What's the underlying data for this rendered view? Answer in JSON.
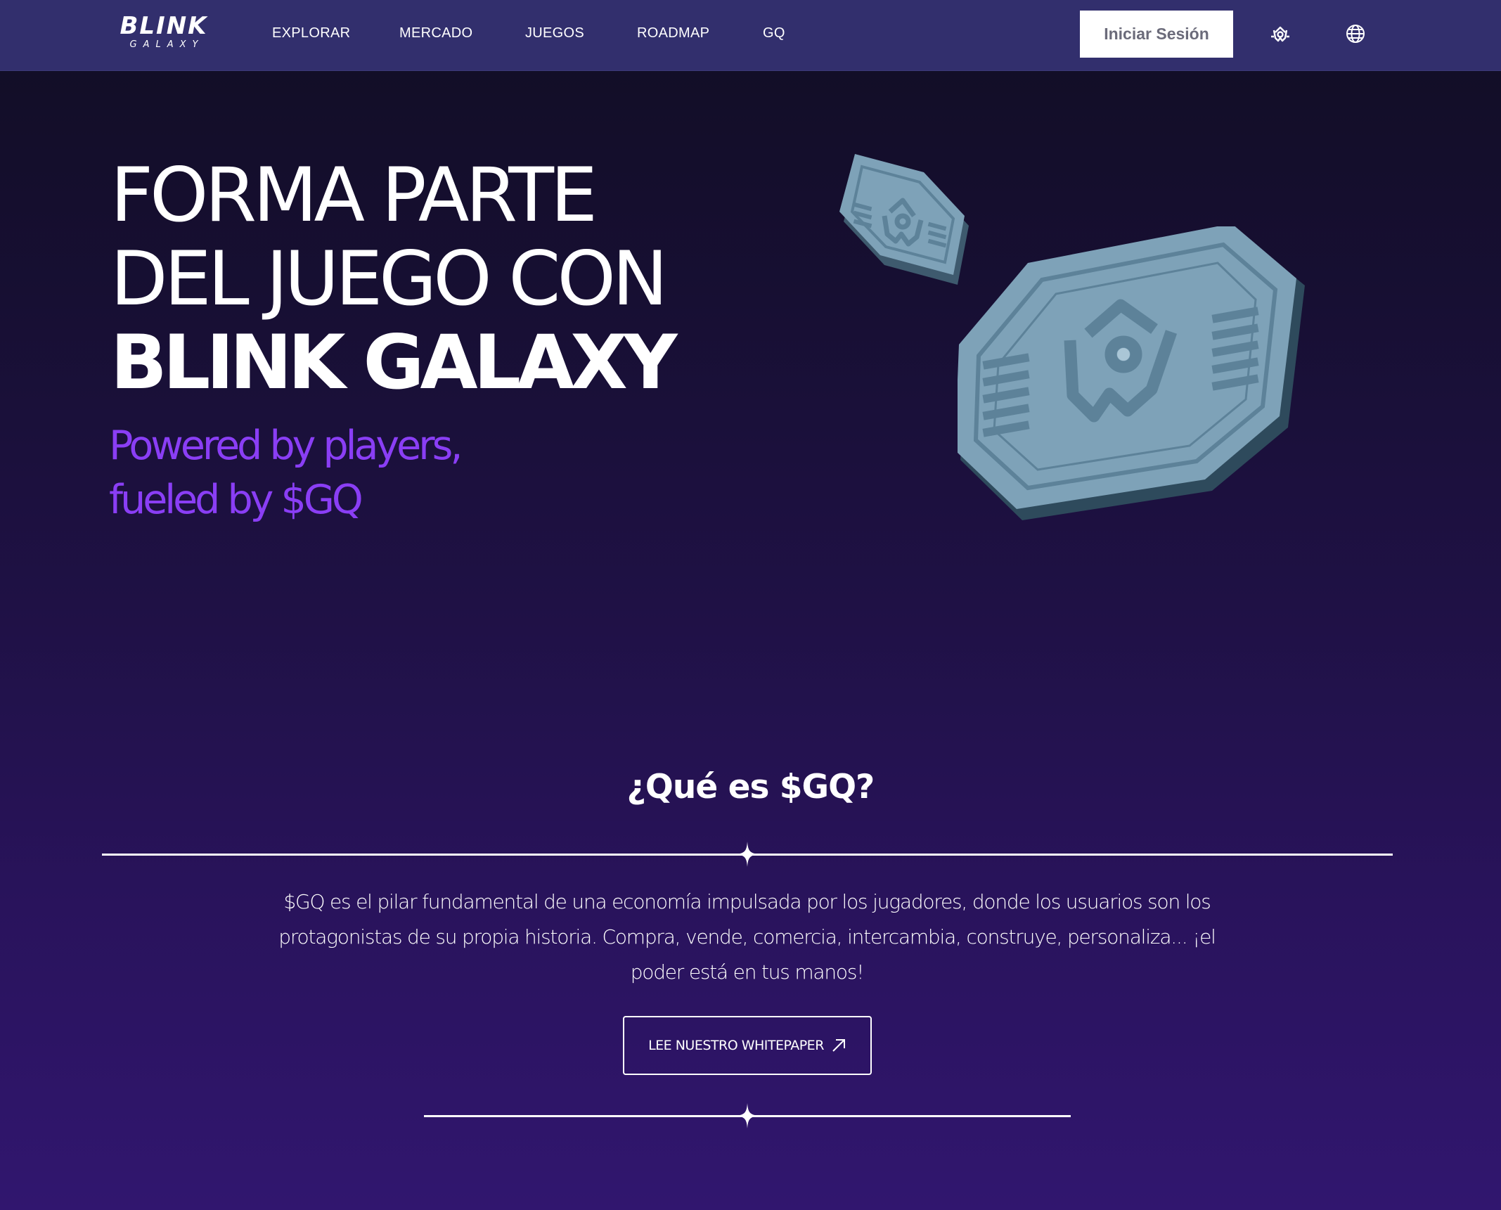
{
  "navbar": {
    "logo_main": "BLINK",
    "logo_sub": "GALAXY",
    "links": [
      "EXPLORAR",
      "MERCADO",
      "JUEGOS",
      "ROADMAP",
      "GQ"
    ],
    "login_label": "Iniciar Sesión",
    "icons": [
      "gq-token-icon",
      "globe-icon"
    ]
  },
  "hero": {
    "title_line1": "FORMA PARTE",
    "title_line2": "DEL JUEGO CON",
    "title_line3": "BLINK GALAXY",
    "subtitle_line1": "Powered by players,",
    "subtitle_line2": "fueled by $GQ"
  },
  "about": {
    "title": "¿Qué es $GQ?",
    "text": "$GQ es el pilar fundamental de una economía impulsada por los jugadores, donde los usuarios son los protagonistas de su propia historia. Compra, vende, comercia, intercambia, construye, personaliza... ¡el poder está en tus manos!",
    "button_label": "LEE NUESTRO WHITEPAPER"
  },
  "colors": {
    "navbar_bg": "#322f6d",
    "accent_purple": "#8a3ef5",
    "coin_face": "#7ea2b8"
  }
}
